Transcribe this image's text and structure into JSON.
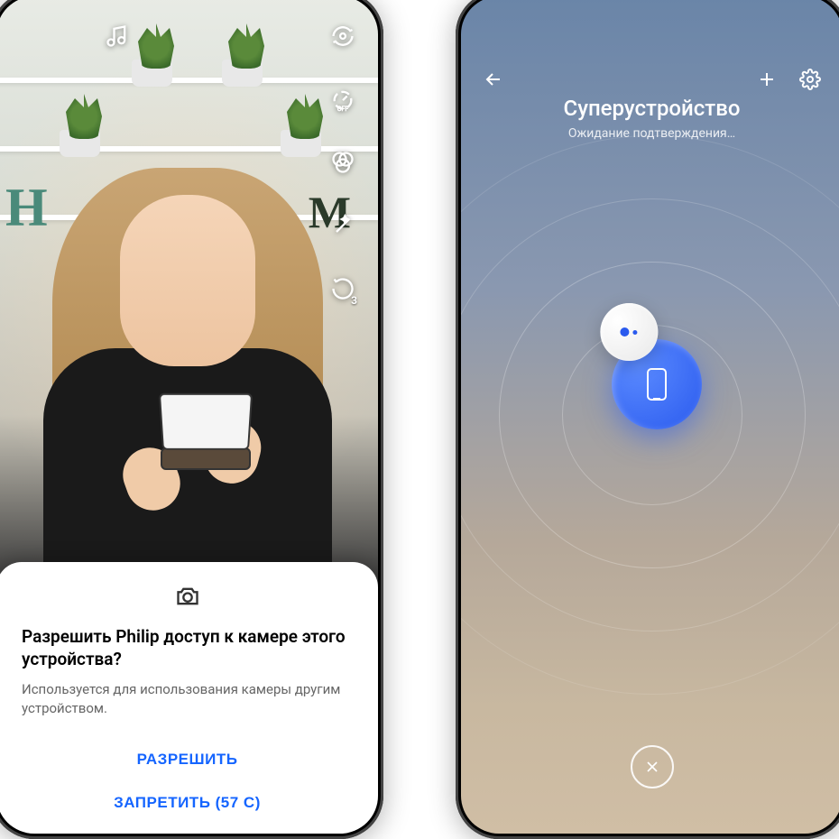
{
  "left_phone": {
    "camera_icons": {
      "music": "music-icon",
      "switch": "camera-switch-icon",
      "timer_off": "timer-off-icon",
      "filter": "filter-icon",
      "beauty": "beauty-wand-icon",
      "timer_3s": "timer-3s-icon",
      "timer_3s_label": "3"
    },
    "permission": {
      "icon": "camera-icon",
      "title": "Разрешить Philip доступ к камере этого устройства?",
      "description": "Используется для использования камеры другим устройством.",
      "allow_button": "РАЗРЕШИТЬ",
      "deny_button": "ЗАПРЕТИТЬ (57 С)"
    }
  },
  "right_phone": {
    "header": {
      "back": "back-icon",
      "add": "add-icon",
      "settings": "settings-icon"
    },
    "title": "Суперустройство",
    "subtitle": "Ожидание подтверждения…",
    "close": "close-icon"
  }
}
